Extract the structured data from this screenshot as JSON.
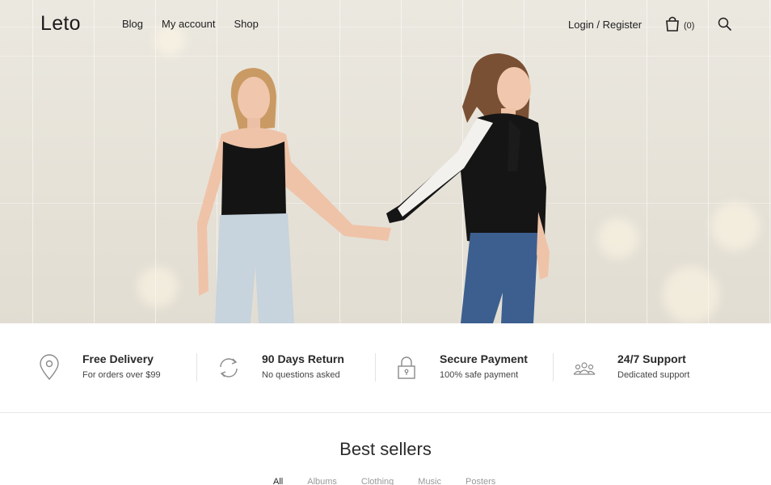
{
  "header": {
    "logo": "Leto",
    "nav": [
      {
        "label": "Blog"
      },
      {
        "label": "My account"
      },
      {
        "label": "Shop"
      }
    ],
    "login_label": "Login / Register",
    "cart_count": "(0)",
    "icons": {
      "cart": "shopping-bag-icon",
      "search": "search-icon"
    }
  },
  "features": [
    {
      "title": "Free Delivery",
      "subtitle": "For orders over $99",
      "icon": "map-pin-icon"
    },
    {
      "title": "90 Days Return",
      "subtitle": "No questions asked",
      "icon": "refresh-icon"
    },
    {
      "title": "Secure Payment",
      "subtitle": "100% safe payment",
      "icon": "lock-icon"
    },
    {
      "title": "24/7 Support",
      "subtitle": "Dedicated support",
      "icon": "support-people-icon"
    }
  ],
  "best_sellers": {
    "title": "Best sellers",
    "filters": [
      "All",
      "Albums",
      "Clothing",
      "Music",
      "Posters"
    ],
    "active_filter": "All"
  },
  "colors": {
    "text": "#222222",
    "muted": "#999999",
    "divider": "#e3e3e3"
  }
}
